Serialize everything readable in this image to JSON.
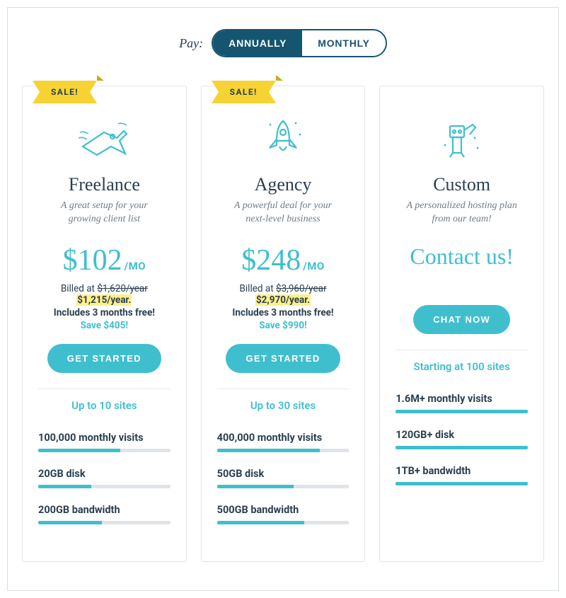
{
  "toggle": {
    "label": "Pay:",
    "annually": "ANNUALLY",
    "monthly": "MONTHLY"
  },
  "plans": [
    {
      "sale": "SALE!",
      "name": "Freelance",
      "tagline": "A great setup for your growing client list",
      "price": "$102",
      "unit": "/MO",
      "billed_prefix": "Billed at ",
      "billed_strike": "$1,620/year",
      "billed_hl": "$1,215/year.",
      "includes": "Includes 3 months free!",
      "save": "Save $405!",
      "cta": "GET STARTED",
      "sites": "Up to 10 sites",
      "features": [
        {
          "label": "100,000 monthly visits",
          "fill": 62
        },
        {
          "label": "20GB disk",
          "fill": 40
        },
        {
          "label": "200GB bandwidth",
          "fill": 48
        }
      ]
    },
    {
      "sale": "SALE!",
      "name": "Agency",
      "tagline": "A powerful deal for your next-level business",
      "price": "$248",
      "unit": "/MO",
      "billed_prefix": "Billed at ",
      "billed_strike": "$3,960/year",
      "billed_hl": "$2,970/year.",
      "includes": "Includes 3 months free!",
      "save": "Save $990!",
      "cta": "GET STARTED",
      "sites": "Up to 30 sites",
      "features": [
        {
          "label": "400,000 monthly visits",
          "fill": 78
        },
        {
          "label": "50GB disk",
          "fill": 58
        },
        {
          "label": "500GB bandwidth",
          "fill": 66
        }
      ]
    },
    {
      "name": "Custom",
      "tagline": "A personalized hosting plan from our team!",
      "contact": "Contact us!",
      "cta": "CHAT NOW",
      "sites": "Starting at 100 sites",
      "features": [
        {
          "label": "1.6M+ monthly visits",
          "fill": 100
        },
        {
          "label": "120GB+ disk",
          "fill": 100
        },
        {
          "label": "1TB+ bandwidth",
          "fill": 100
        }
      ]
    }
  ]
}
